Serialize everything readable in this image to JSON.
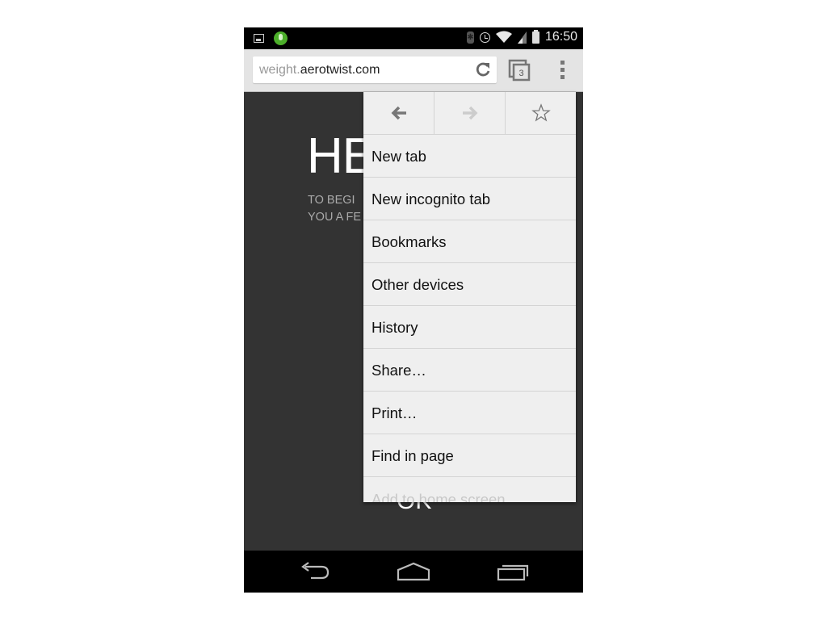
{
  "status_bar": {
    "left_icons": [
      "image-notification-icon",
      "voice-mic-icon"
    ],
    "right_icons": [
      "bluetooth-icon",
      "alarm-icon",
      "wifi-icon",
      "cell-signal-icon",
      "battery-icon"
    ],
    "time": "16:50"
  },
  "toolbar": {
    "url_subdomain": "weight.",
    "url_domain": "aerotwist.com",
    "tab_count": "3",
    "reload_icon": "reload-icon",
    "menu_icon": "overflow-menu-icon"
  },
  "page": {
    "heading": "HE",
    "intro_line1": "TO BEGI",
    "intro_line2": "YOU A FE",
    "ok_label": "OK"
  },
  "menu": {
    "top_actions": [
      {
        "icon": "back-arrow-icon",
        "enabled": true
      },
      {
        "icon": "forward-arrow-icon",
        "enabled": false
      },
      {
        "icon": "bookmark-star-icon",
        "enabled": true
      }
    ],
    "items": [
      {
        "label": "New tab"
      },
      {
        "label": "New incognito tab"
      },
      {
        "label": "Bookmarks"
      },
      {
        "label": "Other devices"
      },
      {
        "label": "History"
      },
      {
        "label": "Share…"
      },
      {
        "label": "Print…"
      },
      {
        "label": "Find in page"
      },
      {
        "label": "Add to home screen"
      }
    ]
  },
  "nav_bar": {
    "buttons": [
      "back-icon",
      "home-icon",
      "recent-apps-icon"
    ]
  },
  "colors": {
    "page_bg": "#333333",
    "menu_bg": "#efefef",
    "toolbar_bg": "#e4e4e4",
    "voice_green": "#4caf2a"
  }
}
